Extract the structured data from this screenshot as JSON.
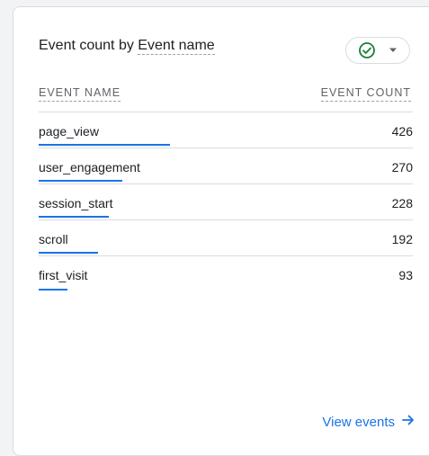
{
  "card": {
    "title_prefix": "Event count by ",
    "title_dimension": "Event name",
    "status_icon": "check-circle-icon",
    "dropdown_icon": "caret-down-icon",
    "accent": "#1a73e8",
    "status_color": "#188038"
  },
  "table": {
    "headers": {
      "name": "EVENT NAME",
      "count": "EVENT COUNT"
    },
    "rows": [
      {
        "name": "page_view",
        "value": "426",
        "share": 1.0
      },
      {
        "name": "user_engagement",
        "value": "270",
        "share": 0.634
      },
      {
        "name": "session_start",
        "value": "228",
        "share": 0.535
      },
      {
        "name": "scroll",
        "value": "192",
        "share": 0.451
      },
      {
        "name": "first_visit",
        "value": "93",
        "share": 0.218
      }
    ]
  },
  "footer": {
    "link_label": "View events",
    "link_icon": "arrow-right-icon"
  }
}
